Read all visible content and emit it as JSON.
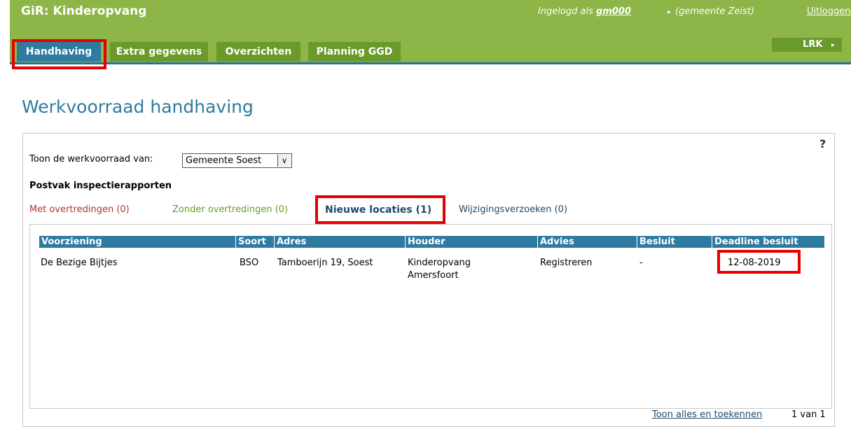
{
  "header": {
    "app_title": "GiR: Kinderopvang",
    "login_prefix": "Ingelogd als ",
    "login_user": "gm000",
    "gemeente": "(gemeente Zeist)",
    "logout": "Uitloggen",
    "lrk": "LRK"
  },
  "tabs": [
    {
      "label": "Handhaving",
      "active": true
    },
    {
      "label": "Extra gegevens",
      "active": false
    },
    {
      "label": "Overzichten",
      "active": false
    },
    {
      "label": "Planning GGD",
      "active": false
    }
  ],
  "page_title": "Werkvoorraad handhaving",
  "help": "?",
  "filter": {
    "label": "Toon de werkvoorraad van:",
    "selected": "Gemeente Soest"
  },
  "postvak": "Postvak inspectierapporten",
  "subtabs": [
    {
      "label": "Met overtredingen (0)"
    },
    {
      "label": "Zonder overtredingen (0)"
    },
    {
      "label": "Nieuwe locaties (1)",
      "active": true
    },
    {
      "label": "Wijzigingsverzoeken (0)"
    }
  ],
  "table": {
    "columns": [
      "Voorziening",
      "Soort",
      "Adres",
      "Houder",
      "Advies",
      "Besluit",
      "Deadline besluit"
    ],
    "rows": [
      {
        "voorziening": "De Bezige Bijtjes",
        "soort": "BSO",
        "adres": "Tamboerijn 19, Soest",
        "houder_1": "Kinderopvang",
        "houder_2": "Amersfoort",
        "advies": "Registreren",
        "besluit": "-",
        "deadline": "12-08-2019"
      }
    ]
  },
  "footer": {
    "link": "Toon alles en toekennen",
    "page": "1 van 1"
  },
  "colors": {
    "header_green": "#8db548",
    "tab_green": "#6a9a2a",
    "accent_blue": "#2e7aa0",
    "highlight_red": "#e60000"
  }
}
